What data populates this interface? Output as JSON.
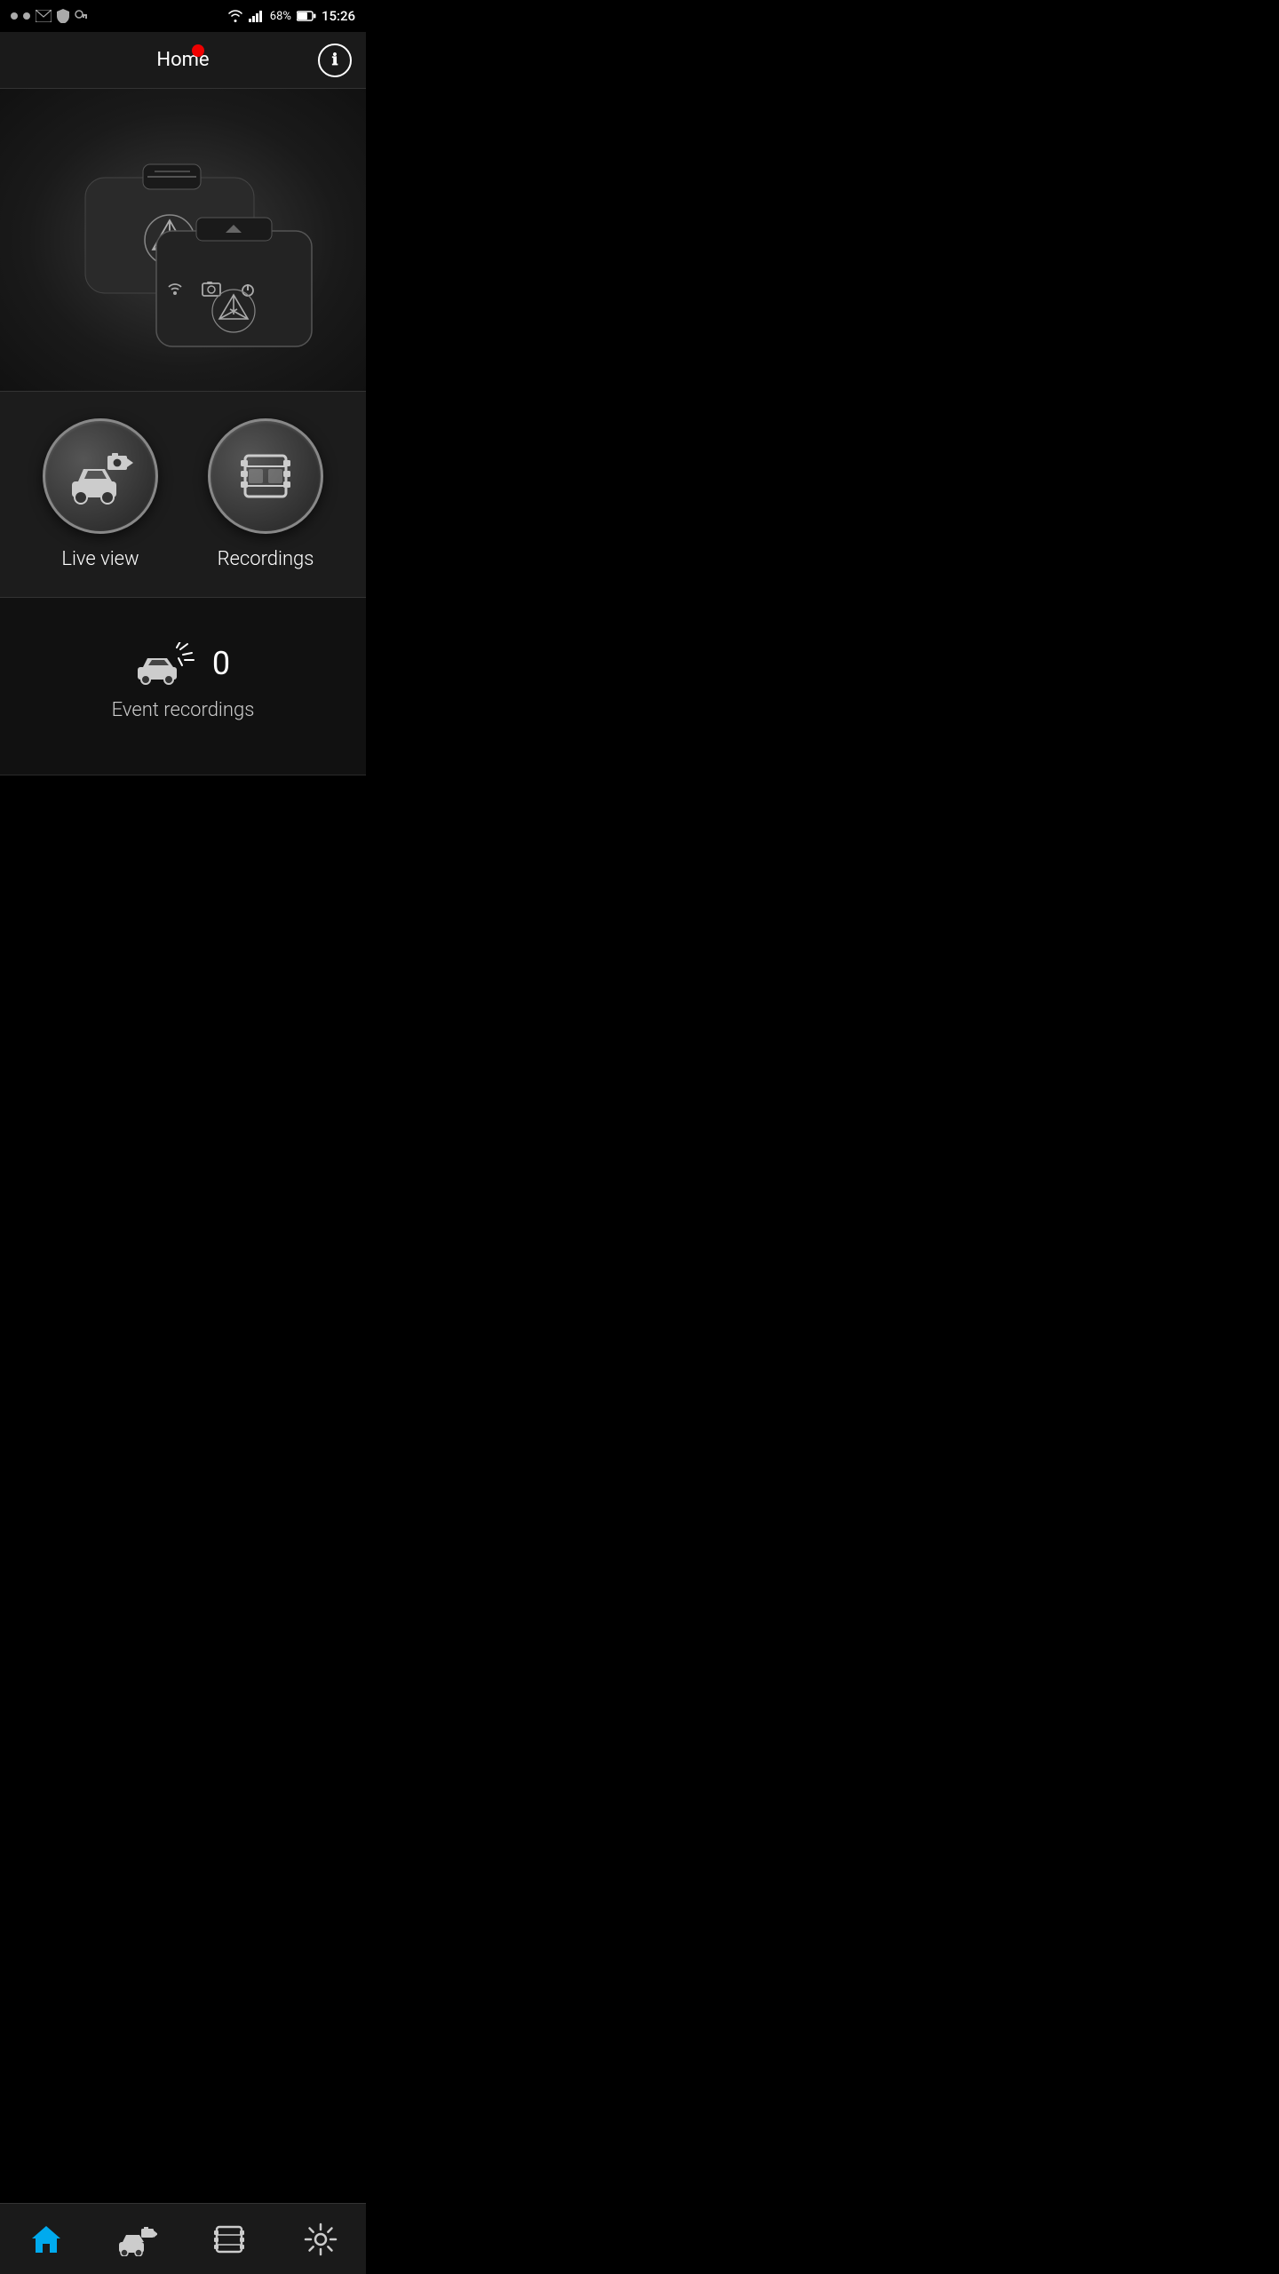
{
  "statusBar": {
    "battery": "68%",
    "time": "15:26",
    "batteryIcon": "battery-icon",
    "wifiIcon": "wifi-icon",
    "signalIcon": "signal-icon"
  },
  "header": {
    "title": "Home",
    "infoButton": "ℹ",
    "recordingDot": true
  },
  "deviceSection": {
    "altText": "Mercedes dashcam devices"
  },
  "mainGrid": {
    "items": [
      {
        "id": "live-view",
        "label": "Live view"
      },
      {
        "id": "recordings",
        "label": "Recordings"
      }
    ]
  },
  "eventSection": {
    "count": "0",
    "label": "Event recordings"
  },
  "bottomNav": {
    "items": [
      {
        "id": "home",
        "label": "Home",
        "active": true
      },
      {
        "id": "live",
        "label": "Live",
        "active": false
      },
      {
        "id": "recordings",
        "label": "Recordings",
        "active": false
      },
      {
        "id": "settings",
        "label": "Settings",
        "active": false
      }
    ]
  }
}
